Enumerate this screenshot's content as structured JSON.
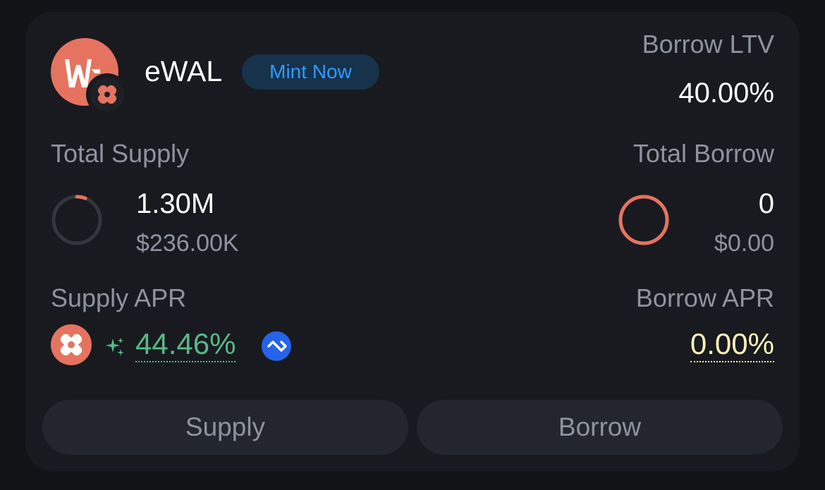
{
  "asset": {
    "name": "eWAL",
    "mint_label": "Mint Now",
    "logo_icon": "walrus-w-icon",
    "badge_icon": "protocol-badge-icon"
  },
  "borrow_ltv": {
    "label": "Borrow LTV",
    "value": "40.00%"
  },
  "total_supply": {
    "label": "Total Supply",
    "amount": "1.30M",
    "usd": "$236.00K",
    "utilization_fraction": 0.06
  },
  "total_borrow": {
    "label": "Total Borrow",
    "amount": "0",
    "usd": "$0.00",
    "utilization_fraction": 1.0
  },
  "supply_apr": {
    "label": "Supply APR",
    "value": "44.46%"
  },
  "borrow_apr": {
    "label": "Borrow APR",
    "value": "0.00%"
  },
  "actions": {
    "supply_label": "Supply",
    "borrow_label": "Borrow"
  },
  "colors": {
    "accent_coral": "#e5735f",
    "apr_green": "#5ab886",
    "apr_yellow": "#fff1b8",
    "mint_blue": "#3399ff"
  }
}
